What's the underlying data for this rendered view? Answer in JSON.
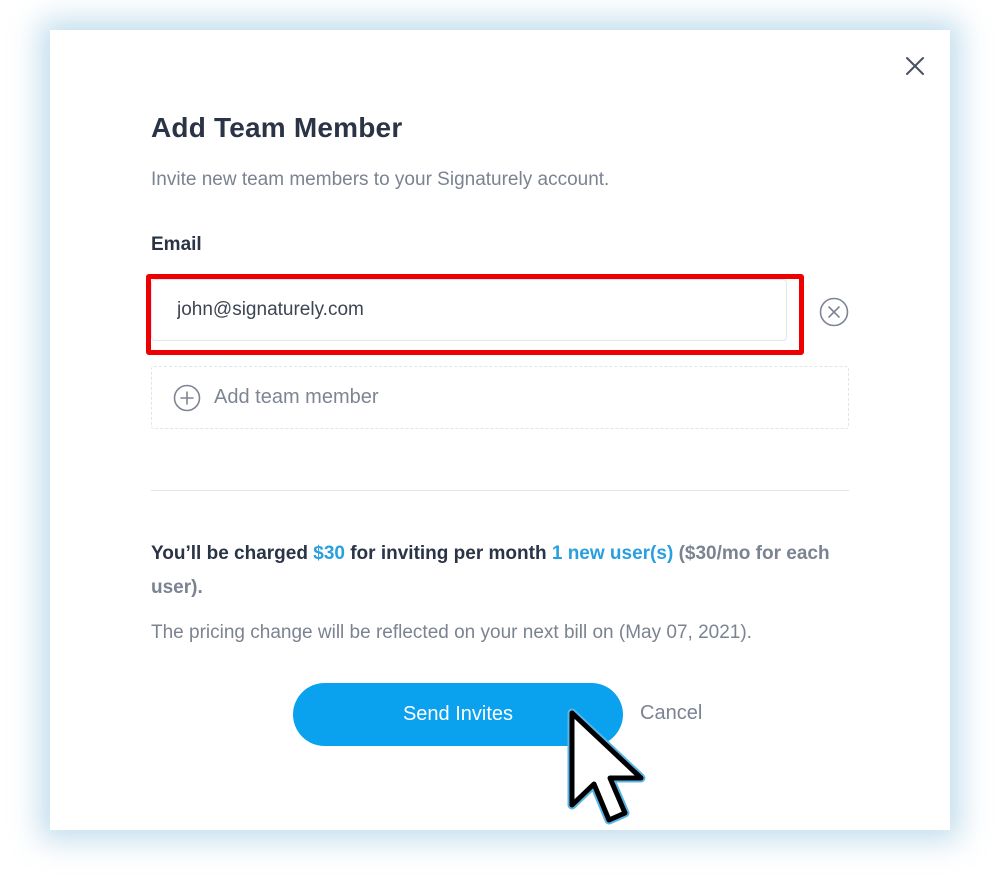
{
  "modal": {
    "title": "Add Team Member",
    "subtitle": "Invite new team members to your Signaturely account.",
    "close_icon": "close-icon"
  },
  "form": {
    "email_label": "Email",
    "email_value": "john@signaturely.com",
    "remove_icon": "circle-x-icon",
    "add_member_label": "Add team member",
    "add_icon": "circle-plus-icon"
  },
  "billing": {
    "charge_prefix": "You’ll be charged",
    "charge_amount": "$30",
    "charge_middle": "for inviting per month",
    "new_users": "1 new user(s)",
    "charge_suffix": "($30/mo for each user).",
    "pricing_note": "The pricing change will be reflected on your next bill on (May 07, 2021)."
  },
  "actions": {
    "send_label": "Send Invites",
    "cancel_label": "Cancel"
  },
  "colors": {
    "accent": "#0aa2ef",
    "highlight": "#ee0000",
    "heading": "#2a3446",
    "muted": "#7b8391"
  }
}
